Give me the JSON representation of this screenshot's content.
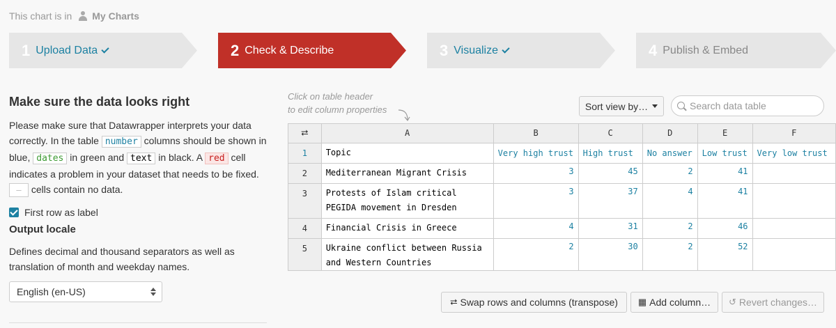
{
  "breadcrumb": {
    "prefix": "This chart is in",
    "folder": "My Charts"
  },
  "steps": [
    {
      "num": "1",
      "label": "Upload Data",
      "state": "done"
    },
    {
      "num": "2",
      "label": "Check & Describe",
      "state": "active"
    },
    {
      "num": "3",
      "label": "Visualize",
      "state": "done"
    },
    {
      "num": "4",
      "label": "Publish & Embed",
      "state": "todo"
    }
  ],
  "left": {
    "title": "Make sure the data looks right",
    "desc": {
      "p1": "Please make sure that Datawrapper interprets your data correctly. In the table",
      "number": "number",
      "p2": "columns should be shown in blue,",
      "dates": "dates",
      "p3": "in green and",
      "text": "text",
      "p4": "in black. A",
      "red": "red",
      "p5": "cell indicates a problem in your dataset that needs to be fixed.",
      "empty": "—",
      "p6": "cells contain no data."
    },
    "first_row_label": "First row as label",
    "output_locale_title": "Output locale",
    "output_locale_desc": "Defines decimal and thousand separators as well as translation of month and weekday names.",
    "locale_value": "English (en-US)"
  },
  "hint": {
    "line1": "Click on table header",
    "line2": "to edit column properties"
  },
  "sort_button": "Sort view by…",
  "search_placeholder": "Search data table",
  "table": {
    "columns": [
      "A",
      "B",
      "C",
      "D",
      "E",
      "F"
    ],
    "header_row": {
      "num": "1",
      "cells": [
        "Topic",
        "Very high trust",
        "High trust",
        "No answer",
        "Low trust",
        "Very low trust"
      ]
    },
    "rows": [
      {
        "num": "2",
        "cells": [
          "Mediterranean Migrant Crisis",
          "3",
          "45",
          "2",
          "41",
          ""
        ]
      },
      {
        "num": "3",
        "cells": [
          "Protests of Islam critical PEGIDA movement in Dresden",
          "3",
          "37",
          "4",
          "41",
          ""
        ]
      },
      {
        "num": "4",
        "cells": [
          "Financial Crisis in Greece",
          "4",
          "31",
          "2",
          "46",
          ""
        ]
      },
      {
        "num": "5",
        "cells": [
          "Ukraine conflict between Russia and Western Countries",
          "2",
          "30",
          "2",
          "52",
          ""
        ]
      }
    ]
  },
  "buttons": {
    "transpose": "Swap rows and columns (transpose)",
    "add_column": "Add column…",
    "revert": "Revert changes…"
  },
  "colors": {
    "accent": "#1d81a2",
    "active_step": "#c03028"
  }
}
